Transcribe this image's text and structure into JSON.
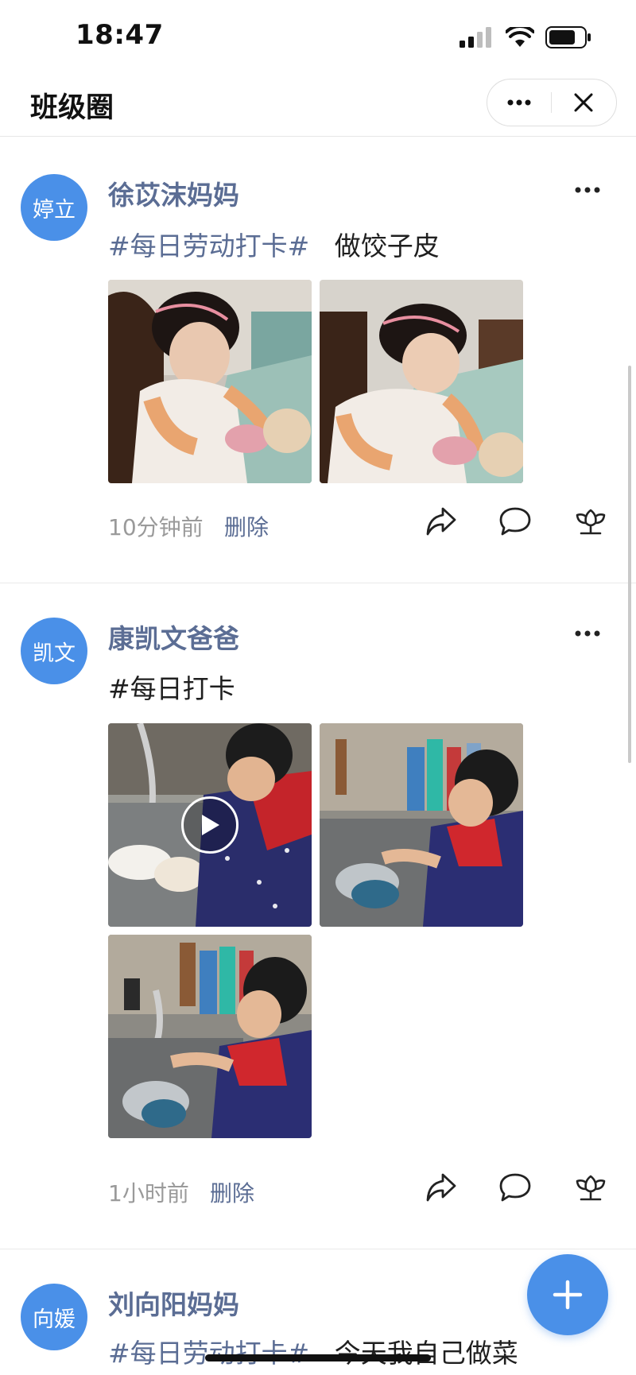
{
  "status_bar": {
    "time": "18:47"
  },
  "nav": {
    "title": "班级圈"
  },
  "posts": [
    {
      "avatar_text": "婷立",
      "author": "徐苡沫妈妈",
      "tag": "#每日劳动打卡#",
      "text": "做饺子皮",
      "time": "10分钟前",
      "delete_label": "删除"
    },
    {
      "avatar_text": "凯文",
      "author": "康凯文爸爸",
      "tag": "#每日打卡",
      "text": "",
      "time": "1小时前",
      "delete_label": "删除"
    },
    {
      "avatar_text": "向媛",
      "author": "刘向阳妈妈",
      "tag": "#每日劳动打卡#",
      "text": "今天我自己做菜"
    }
  ],
  "colors": {
    "accent": "#4a90e8",
    "link": "#5b6d94",
    "muted": "#9a9a9a"
  },
  "icons": [
    "ellipsis-icon",
    "close-icon",
    "share-icon",
    "comment-icon",
    "like-flower-icon",
    "play-icon",
    "plus-icon"
  ]
}
